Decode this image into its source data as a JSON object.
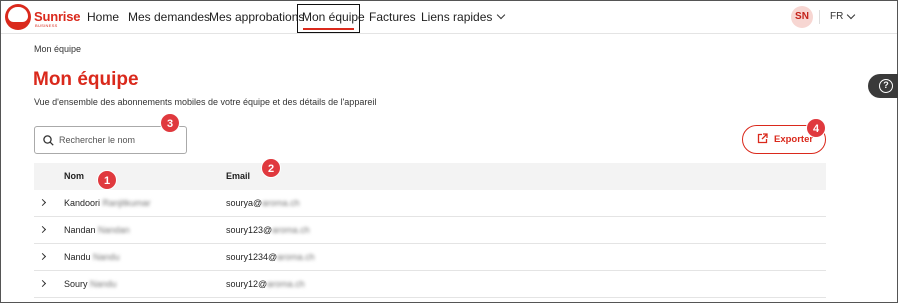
{
  "header": {
    "brand": "Sunrise",
    "brand_sub": "BUSINESS",
    "nav": [
      {
        "label": "Home"
      },
      {
        "label": "Mes demandes"
      },
      {
        "label": "Mes approbations"
      },
      {
        "label": "Mon équipe",
        "active": true
      },
      {
        "label": "Factures"
      },
      {
        "label": "Liens rapides"
      }
    ],
    "avatar_initials": "SN",
    "language": "FR"
  },
  "breadcrumb": "Mon équipe",
  "page": {
    "title": "Mon équipe",
    "subtitle": "Vue d'ensemble des abonnements mobiles de votre équipe et des détails de l'appareil"
  },
  "search": {
    "placeholder": "Rechercher le nom",
    "value": ""
  },
  "export_label": "Exporter",
  "table": {
    "columns": [
      "Nom",
      "Email"
    ],
    "rows": [
      {
        "first": "Kandoori",
        "last": "Ranjitkumar",
        "email_user": "sourya@",
        "email_domain": "aroma.ch"
      },
      {
        "first": "Nandan",
        "last": "Nandan",
        "email_user": "soury123@",
        "email_domain": "aroma.ch"
      },
      {
        "first": "Nandu",
        "last": "Nandu",
        "email_user": "soury1234@",
        "email_domain": "aroma.ch"
      },
      {
        "first": "Soury",
        "last": "Nandu",
        "email_user": "soury12@",
        "email_domain": "aroma.ch"
      }
    ]
  },
  "markers": [
    "1",
    "2",
    "3",
    "4"
  ],
  "colors": {
    "accent": "#da291c",
    "marker": "#e0393e"
  }
}
